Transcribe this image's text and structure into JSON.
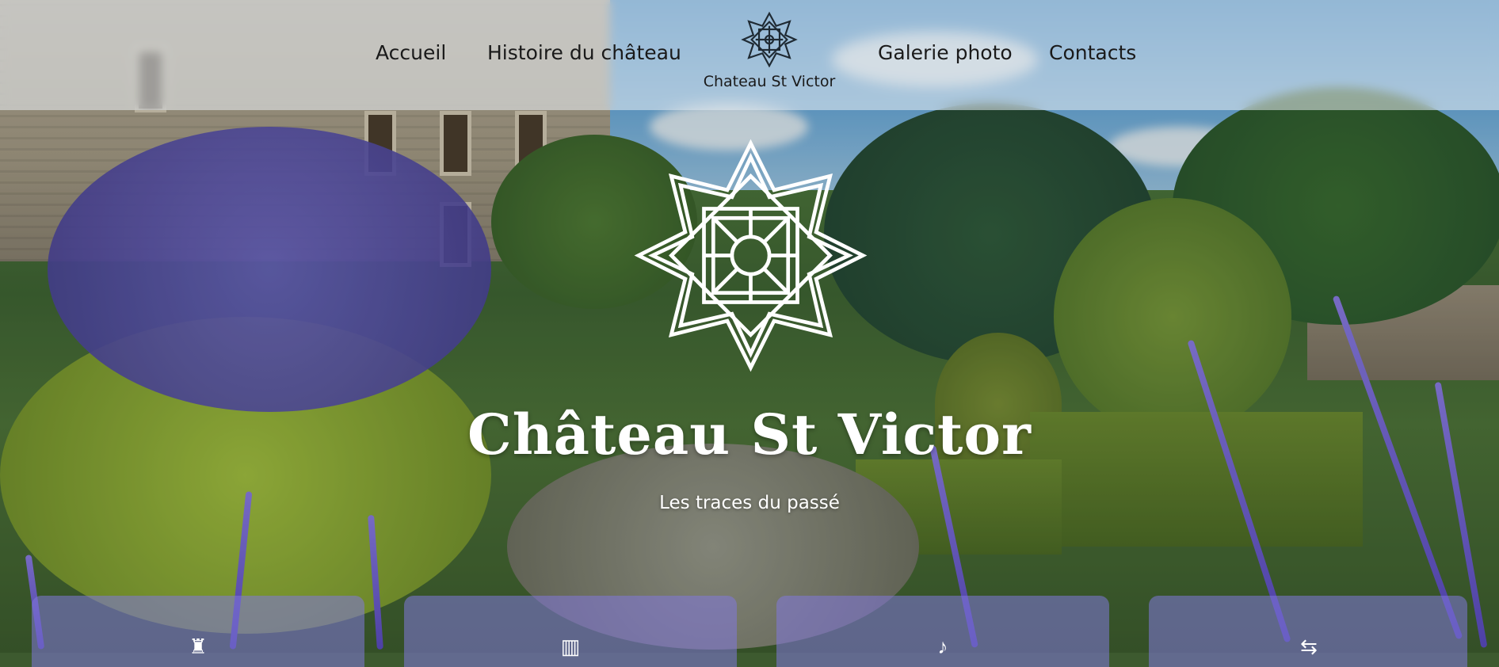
{
  "header": {
    "nav_left": [
      {
        "label": "Accueil"
      },
      {
        "label": "Histoire du château"
      }
    ],
    "nav_right": [
      {
        "label": "Galerie photo"
      },
      {
        "label": "Contacts"
      }
    ],
    "logo_text": "Chateau St Victor"
  },
  "hero": {
    "title": "Château St Victor",
    "subtitle": "Les traces du passé"
  },
  "cards": [
    {
      "icon": "castle-icon"
    },
    {
      "icon": "building-icon"
    },
    {
      "icon": "music-note-icon"
    },
    {
      "icon": "signpost-icon"
    }
  ],
  "colors": {
    "header_text": "#1a1a1a",
    "hero_text": "#ffffff",
    "card_bg": "#8278dc"
  }
}
